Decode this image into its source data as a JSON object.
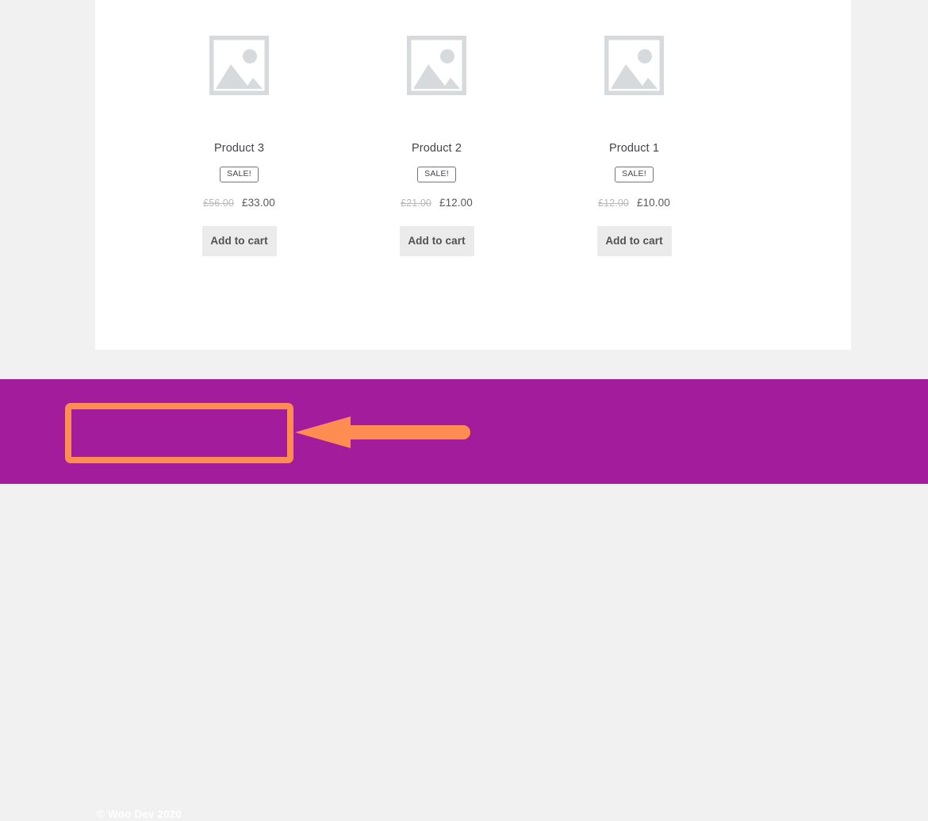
{
  "page": {
    "background_color": "#f1f1f1",
    "content_background": "#ffffff"
  },
  "shop": {
    "products": [
      {
        "name": "Product 3",
        "badge": "SALE!",
        "price_old": "£56.00",
        "price_new": "£33.00",
        "add_to_cart_label": "Add to cart",
        "thumbnail_icon": "image-placeholder-icon"
      },
      {
        "name": "Product 2",
        "badge": "SALE!",
        "price_old": "£21.00",
        "price_new": "£12.00",
        "add_to_cart_label": "Add to cart",
        "thumbnail_icon": "image-placeholder-icon"
      },
      {
        "name": "Product 1",
        "badge": "SALE!",
        "price_old": "£12.00",
        "price_new": "£10.00",
        "add_to_cart_label": "Add to cart",
        "thumbnail_icon": "image-placeholder-icon"
      }
    ]
  },
  "footer": {
    "background_color": "#a31c9c",
    "copyright": "© Woo Dev 2020"
  },
  "annotation": {
    "highlight_color": "#ff8c51",
    "arrow_color": "#ff8c51",
    "arrow_direction": "left",
    "target": "footer-copyright"
  }
}
